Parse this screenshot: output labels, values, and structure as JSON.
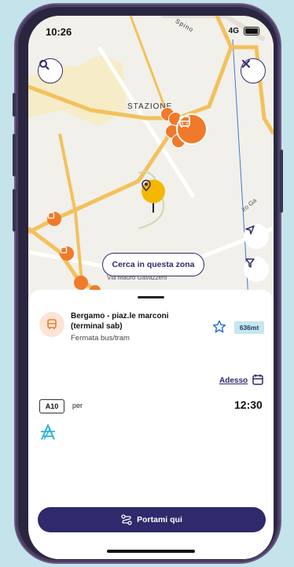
{
  "status": {
    "time": "10:26",
    "network": "4G"
  },
  "map": {
    "area_label": "STAZIONE",
    "street_label": "Via Mauro Gavazzeni",
    "side_street_label": "iro Ga",
    "top_street_label": "Spino",
    "search_zone_label": "Cerca in questa zona"
  },
  "stop": {
    "name": "Bergamo - piaz.le marconi (terminal sab)",
    "type": "Fermata bus/tram",
    "distance": "636mt"
  },
  "schedule": {
    "when_label": "Adesso",
    "departures": [
      {
        "line": "A10",
        "direction_prefix": "per",
        "time": "12:30"
      }
    ]
  },
  "cta": {
    "label": "Portami qui"
  },
  "colors": {
    "accent": "#2e2a6b",
    "bus_marker": "#f07a2a",
    "selected_pin": "#f5b800",
    "road": "#f3c15c",
    "distance_badge": "#c6e6f1"
  },
  "icons": [
    "search-icon",
    "close-icon",
    "navigation-arrow-icon",
    "filter-icon",
    "bus-icon",
    "star-icon",
    "calendar-icon",
    "route-icon",
    "operator-logo-icon",
    "location-pin-icon"
  ]
}
